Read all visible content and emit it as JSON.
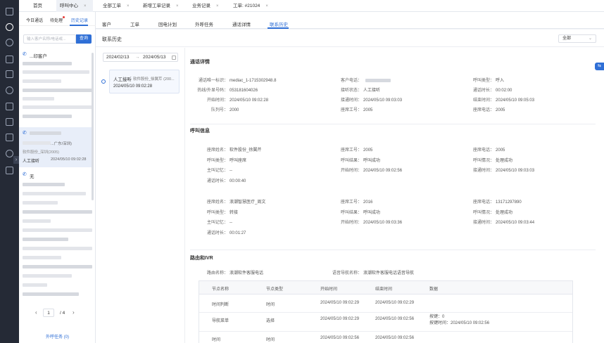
{
  "top_tabs": [
    {
      "label": "首页",
      "closable": false,
      "active": false
    },
    {
      "label": "呼叫中心",
      "closable": true,
      "active": true
    },
    {
      "label": "全部工单",
      "closable": true,
      "active": false
    },
    {
      "label": "新增工单记录",
      "closable": true,
      "active": false
    },
    {
      "label": "业务记录",
      "closable": true,
      "active": false
    },
    {
      "label": "工单: #21024",
      "closable": true,
      "active": false
    }
  ],
  "left_panel": {
    "tabs": [
      "今日通话",
      "待处理",
      "历史记录"
    ],
    "search_placeholder": "输入客户名称/电话或...",
    "search_button": "查询",
    "items": [
      {
        "title": "...印客户"
      },
      {
        "line2": "...广东/深圳)",
        "line3": "软件股份_深圳(2005)",
        "type": "人工接听",
        "time": "2024/05/10 09:02:28"
      },
      {
        "title": "无"
      }
    ],
    "pager": {
      "current": "1",
      "total": "/ 4"
    },
    "footer_link": "外呼任务 (0)"
  },
  "main_tabs": [
    "客户",
    "工单",
    "回电计划",
    "外呼任务",
    "通话详情",
    "联系历史"
  ],
  "contact_history": {
    "title": "联系历史",
    "date_from": "2024/02/13",
    "date_to": "2024/05/13",
    "record": {
      "type": "人工接听",
      "agent": "软件股份_徐翼芹 (200...",
      "time": "2024/05/10 09:02:28"
    },
    "filter": "全部"
  },
  "call_detail": {
    "title": "通话详情",
    "rows": [
      [
        [
          "通话唯一标识",
          "mediac_1-1715302948.8"
        ],
        [
          "客户电话",
          ""
        ],
        [
          "呼叫类型",
          "呼入"
        ]
      ],
      [
        [
          "热线/外显号码",
          "053181604026"
        ],
        [
          "接听状态",
          "人工接听"
        ],
        [
          "通话时长",
          "00:02:00"
        ]
      ],
      [
        [
          "开始时间",
          "2024/05/10 09:02:28"
        ],
        [
          "接通时间",
          "2024/05/10 09:03:03"
        ],
        [
          "结束时间",
          "2024/05/10 09:05:03"
        ]
      ],
      [
        [
          "队列号",
          "2000"
        ],
        [
          "座席工号",
          "2005"
        ],
        [
          "座席电话",
          "2005"
        ]
      ]
    ]
  },
  "call_info": {
    "title": "呼叫信息",
    "groups": [
      [
        [
          [
            "座席姓名",
            "软件股份_徐翼芹"
          ],
          [
            "座席工号",
            "2005"
          ],
          [
            "座席电话",
            "2005"
          ]
        ],
        [
          [
            "呼叫类型",
            "呼叫座席"
          ],
          [
            "呼叫结果",
            "呼叫成功"
          ],
          [
            "呼叫情况",
            "处理成功"
          ]
        ],
        [
          [
            "主叫记忆",
            "--"
          ],
          [
            "开始时间",
            "2024/05/10 09:02:56"
          ],
          [
            "接通时间",
            "2024/05/10 09:03:03"
          ]
        ],
        [
          [
            "通话时长",
            "00:00:40"
          ]
        ]
      ],
      [
        [
          [
            "座席姓名",
            "浪潮智慧医疗_周文"
          ],
          [
            "座席工号",
            "2016"
          ],
          [
            "座席电话",
            "13171297890"
          ]
        ],
        [
          [
            "呼叫类型",
            "转接"
          ],
          [
            "呼叫结果",
            "呼叫成功"
          ],
          [
            "呼叫情况",
            "处理成功"
          ]
        ],
        [
          [
            "主叫记忆",
            "--"
          ],
          [
            "开始时间",
            "2024/05/10 09:03:36"
          ],
          [
            "接通时间",
            "2024/05/10 09:03:44"
          ]
        ],
        [
          [
            "通话时长",
            "00:01:27"
          ]
        ]
      ]
    ]
  },
  "ivr": {
    "title": "路由和IVR",
    "route_name_label": "路由名称",
    "route_name": "浪潮软件客服电话",
    "nav_name_label": "语音导航名称",
    "nav_name": "浪潮软件客服电话语音导航",
    "columns": [
      "节点名称",
      "节点类型",
      "开始时间",
      "结束时间",
      "数据"
    ],
    "rows": [
      [
        "时间判断",
        "时间",
        "2024/05/10 09:02:29",
        "2024/05/10 09:02:29",
        ""
      ],
      [
        "导航菜单",
        "选择",
        "2024/05/10 09:02:29",
        "2024/05/10 09:02:56",
        "按键：0|按键时间：2024/05/10 09:02:56"
      ],
      [
        "时间",
        "时间",
        "2024/05/10 09:02:56",
        "2024/05/10 09:02:56",
        ""
      ]
    ]
  }
}
